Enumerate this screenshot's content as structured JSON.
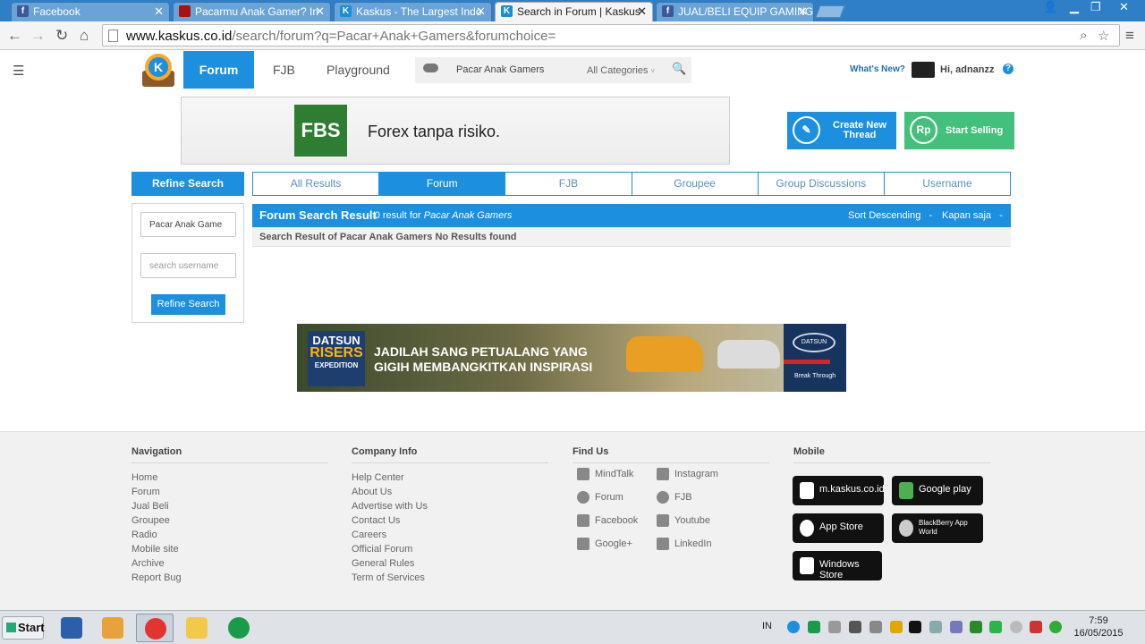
{
  "browser": {
    "tabs": [
      {
        "title": "Facebook"
      },
      {
        "title": "Pacarmu Anak Gamer? In"
      },
      {
        "title": "Kaskus - The Largest Indo"
      },
      {
        "title": "Search in Forum | Kaskus"
      },
      {
        "title": "JUAL/BELI EQUIP GAMING"
      }
    ],
    "url_host": "www.kaskus.co.id",
    "url_path": "/search/forum?q=Pacar+Anak+Gamers&forumchoice="
  },
  "header": {
    "nav": {
      "forum": "Forum",
      "fjb": "FJB",
      "playground": "Playground"
    },
    "search_query": "Pacar Anak Gamers",
    "category": "All Categories",
    "whats_new": "What's New?",
    "greeting": "Hi, adnanzz"
  },
  "ad_top": {
    "brand": "FBS",
    "text": "Forex tanpa risiko."
  },
  "actions": {
    "create_thread": "Create New Thread",
    "start_selling": "Start Selling",
    "create_icon_text": "✎",
    "sell_icon_text": "Rp"
  },
  "refine": {
    "title": "Refine Search",
    "query_value": "Pacar Anak Game",
    "username_placeholder": "search username",
    "button": "Refine Search"
  },
  "result_tabs": [
    "All Results",
    "Forum",
    "FJB",
    "Groupee",
    "Group Discussions",
    "Username"
  ],
  "results": {
    "title": "Forum Search Result",
    "count_prefix": " - 0 result for ",
    "count_query": "Pacar Anak Gamers",
    "sort": "Sort Descending",
    "time": "Kapan saja",
    "message": "Search Result of Pacar Anak Gamers No Results found"
  },
  "ad_bottom": {
    "badge_1": "DATSUN",
    "badge_2": "RISERS",
    "badge_3": "EXPEDITION",
    "line_1": "JADILAH SANG PETUALANG YANG",
    "line_2": "GIGIH MEMBANGKITKAN INSPIRASI",
    "logo": "DATSUN",
    "tagline": "Break Through"
  },
  "footer": {
    "navigation": {
      "title": "Navigation",
      "links": [
        "Home",
        "Forum",
        "Jual Beli",
        "Groupee",
        "Radio",
        "Mobile site",
        "Archive",
        "Report Bug"
      ]
    },
    "company": {
      "title": "Company Info",
      "links": [
        "Help Center",
        "About Us",
        "Advertise with Us",
        "Contact Us",
        "Careers",
        "Official Forum",
        "General Rules",
        "Term of Services"
      ]
    },
    "find_us": {
      "title": "Find Us",
      "links": [
        "MindTalk",
        "Instagram",
        "Forum",
        "FJB",
        "Facebook",
        "Youtube",
        "Google+",
        "LinkedIn"
      ]
    },
    "mobile": {
      "title": "Mobile",
      "apps": [
        "m.kaskus.co.id",
        "Google play",
        "App Store",
        "BlackBerry App World",
        "Windows Store"
      ]
    }
  },
  "taskbar": {
    "start": "Start",
    "lang": "IN",
    "time": "7:59",
    "date": "16/05/2015"
  }
}
